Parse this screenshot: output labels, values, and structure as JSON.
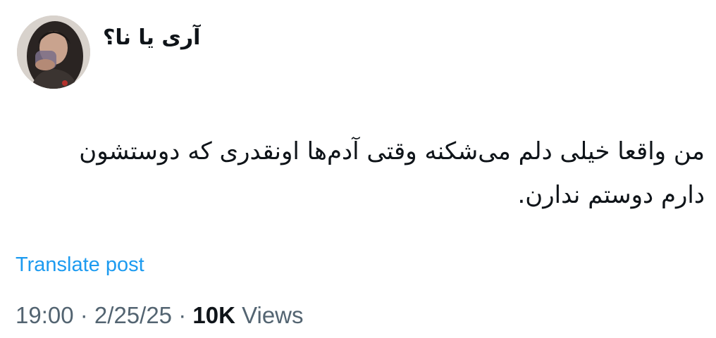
{
  "post": {
    "author": {
      "display_name": "آری یا نا؟",
      "avatar_icon": "profile-photo"
    },
    "text": "من واقعا خیلی دلم می‌شکنه وقتی آدم‌ها اونقدری که دوستشون\nدارم دوستم ندارن.",
    "translate_label": "Translate post",
    "meta": {
      "time": "19:00",
      "separator_1": " · ",
      "date": "2/25/25",
      "separator_2": " · ",
      "views_count": "10K",
      "views_label": " Views"
    }
  },
  "colors": {
    "text": "#0f1419",
    "secondary": "#536471",
    "link": "#1d9bf0",
    "background": "#ffffff"
  }
}
